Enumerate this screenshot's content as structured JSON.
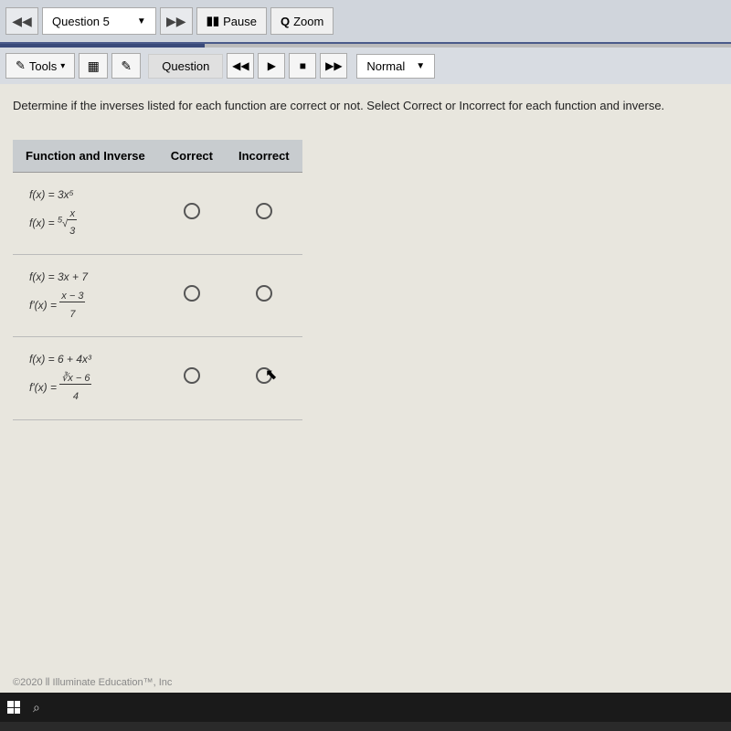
{
  "toolbar": {
    "question_label": "Question 5",
    "pause_label": "Pause",
    "zoom_label": "Zoom"
  },
  "second_toolbar": {
    "tools_label": "Tools",
    "question_label": "Question",
    "normal_label": "Normal"
  },
  "question_text": "Determine if the inverses listed for each function are correct or not.  Select Correct or Incorrect for each function and inverse.",
  "table": {
    "headers": [
      "Function and Inverse",
      "Correct",
      "Incorrect"
    ],
    "rows": [
      {
        "f": "f(x) = 3x⁵",
        "finv_pre": "f(x) = ",
        "finv_root": "5",
        "finv_num": "x",
        "finv_den": "3"
      },
      {
        "f": "f(x) = 3x + 7",
        "finv_pre": "f'(x) = ",
        "finv_num": "x − 3",
        "finv_den": "7"
      },
      {
        "f": "f(x) = 6 + 4x³",
        "finv_pre": "f'(x) = ",
        "finv_num": "∛x − 6",
        "finv_den": "4"
      }
    ]
  },
  "footer": "©2020 ⦀ Illuminate Education™, Inc"
}
